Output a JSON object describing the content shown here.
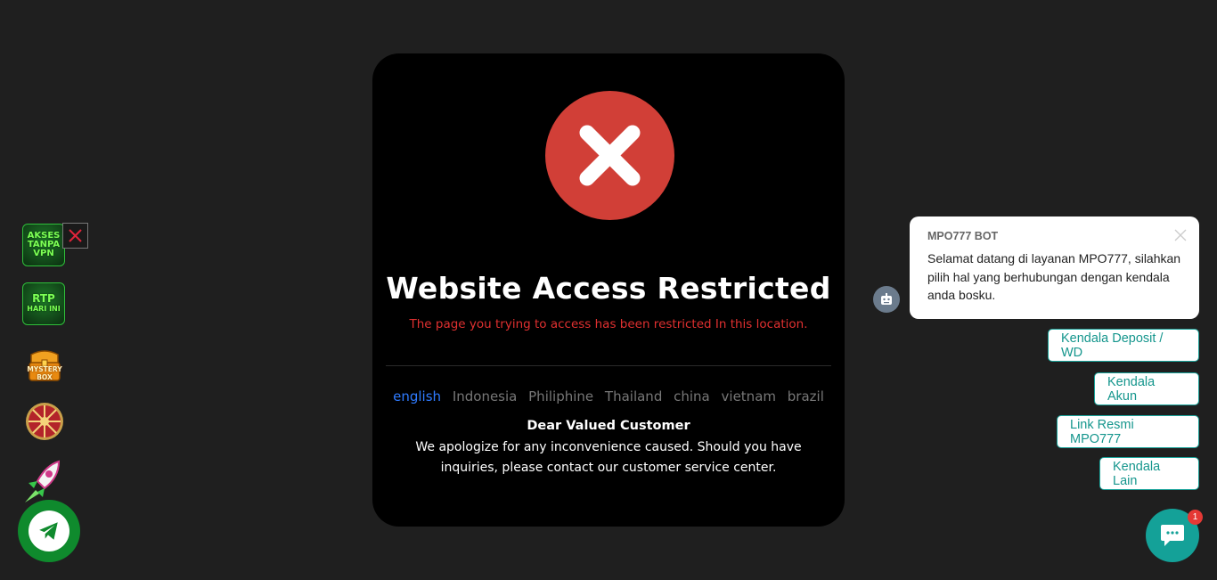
{
  "modal": {
    "title": "Website Access Restricted",
    "subtitle": "The page you trying to access has been restricted In this location.",
    "languages": [
      "english",
      "Indonesia",
      "Philiphine",
      "Thailand",
      "china",
      "vietnam",
      "brazil"
    ],
    "active_language": "english",
    "greeting": "Dear Valued Customer",
    "message": "We apologize for any inconvenience caused. Should you have inquiries, please contact our customer service center."
  },
  "side_menu": {
    "tile1_lines": [
      "AKSES",
      "TANPA",
      "VPN"
    ],
    "tile2_lines": [
      "RTP",
      "HARI INI"
    ],
    "mystery_label": "MYSTERY BOX"
  },
  "chat": {
    "bot_name": "MPO777 BOT",
    "bot_message": "Selamat datang di layanan MPO777, silahkan pilih hal yang berhubungan dengan kendala anda bosku.",
    "quick_replies": [
      "Kendala Deposit / WD",
      "Kendala Akun",
      "Link Resmi MPO777",
      "Kendala Lain"
    ],
    "unread_count": "1"
  },
  "colors": {
    "page_bg": "#1f1f1f",
    "error_red": "#d13f37",
    "link_blue": "#2f7bff",
    "chat_teal": "#14a198",
    "telegram_green": "#0f8a2d"
  }
}
